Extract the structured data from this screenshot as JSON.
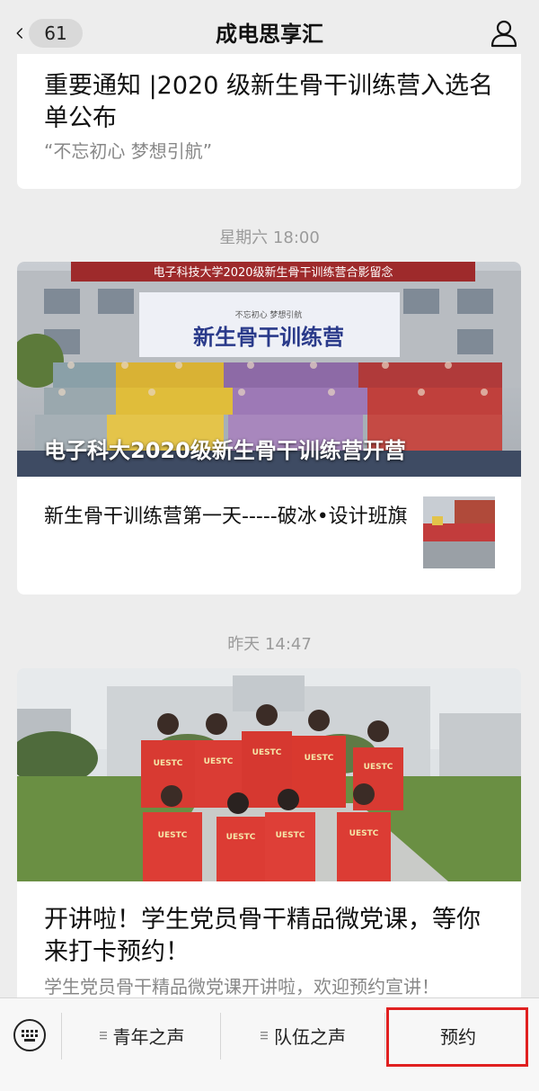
{
  "header": {
    "title": "成电思享汇",
    "unread_count": "61",
    "back_icon": "chevron-left-icon",
    "profile_icon": "person-icon"
  },
  "messages": [
    {
      "headline": "重要通知 |2020 级新生骨干训练营入选名单公布",
      "digest": "“不忘初心 梦想引航”"
    }
  ],
  "timestamps": [
    "星期六 18:00",
    "昨天 14:47"
  ],
  "article_group": {
    "cover_caption": "电子科大2020级新生骨干训练营开营",
    "sub_title": "新生骨干训练营第一天-----破冰•设计班旗",
    "banner": {
      "title": "电子科技大学2020级新生骨干训练营合影留念",
      "board_title": "新生骨干训练营",
      "board_sub": "不忘初心 梦想引航"
    }
  },
  "article_single": {
    "headline": "开讲啦！学生党员骨干精品微党课，等你来打卡预约！",
    "digest": "学生党员骨干精品微党课开讲啦，欢迎预约宣讲！",
    "shirt_text": "UESTC"
  },
  "menu": {
    "keyboard_icon": "keyboard-icon",
    "items": [
      {
        "label": "青年之声"
      },
      {
        "label": "队伍之声"
      },
      {
        "label": "预约"
      }
    ]
  },
  "colors": {
    "background": "#ededed",
    "highlight": "#e02020",
    "banner_red": "#c0392b"
  }
}
